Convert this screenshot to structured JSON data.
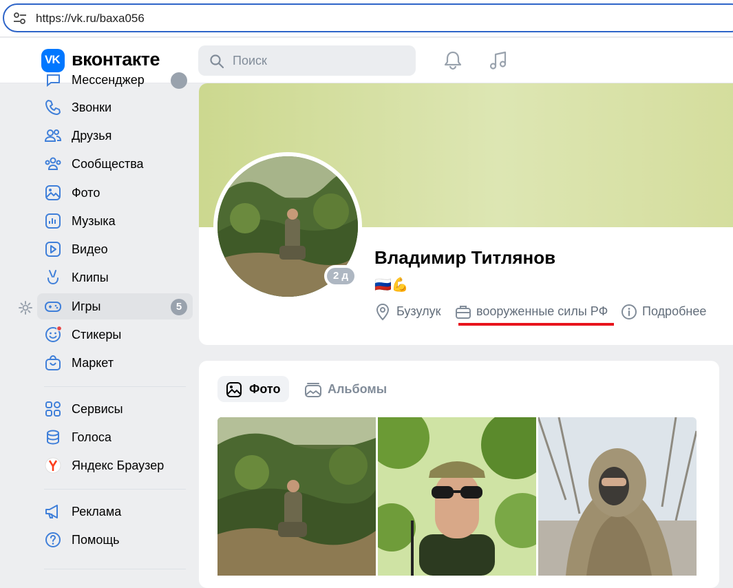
{
  "browser": {
    "url": "https://vk.ru/baxa056"
  },
  "header": {
    "brand": "вконтакте",
    "logo_text": "VK",
    "search_placeholder": "Поиск"
  },
  "menu": {
    "partial_item": "Мессенджер",
    "items": [
      {
        "id": "calls",
        "label": "Звонки",
        "icon": "phone-icon"
      },
      {
        "id": "friends",
        "label": "Друзья",
        "icon": "friends-icon"
      },
      {
        "id": "communities",
        "label": "Сообщества",
        "icon": "communities-icon"
      },
      {
        "id": "photos",
        "label": "Фото",
        "icon": "photo-icon"
      },
      {
        "id": "music",
        "label": "Музыка",
        "icon": "music-icon"
      },
      {
        "id": "video",
        "label": "Видео",
        "icon": "video-icon"
      },
      {
        "id": "clips",
        "label": "Клипы",
        "icon": "clips-icon"
      },
      {
        "id": "games",
        "label": "Игры",
        "icon": "gamepad-icon",
        "badge": "5",
        "active": true
      },
      {
        "id": "stickers",
        "label": "Стикеры",
        "icon": "smile-icon",
        "dot": true
      },
      {
        "id": "market",
        "label": "Маркет",
        "icon": "bag-icon"
      }
    ],
    "items2": [
      {
        "id": "services",
        "label": "Сервисы",
        "icon": "grid-icon"
      },
      {
        "id": "votes",
        "label": "Голоса",
        "icon": "coins-icon"
      },
      {
        "id": "yandex",
        "label": "Яндекс Браузер",
        "icon": "yandex-icon"
      }
    ],
    "items3": [
      {
        "id": "ads",
        "label": "Реклама",
        "icon": "megaphone-icon"
      },
      {
        "id": "help",
        "label": "Помощь",
        "icon": "help-icon"
      }
    ]
  },
  "profile": {
    "name": "Владимир Титлянов",
    "status": "🇷🇺💪",
    "online": "2 д",
    "city": "Бузулук",
    "work": "вооруженные силы РФ",
    "more": "Подробнее"
  },
  "photos_block": {
    "tabs": [
      {
        "label": "Фото",
        "icon": "photo-icon",
        "active": true
      },
      {
        "label": "Альбомы",
        "icon": "albums-icon",
        "active": false
      }
    ]
  },
  "colors": {
    "accent": "#0077ff",
    "cover": "#d4dd9c",
    "underline": "#e8141c",
    "badge": "#99a2ad"
  }
}
